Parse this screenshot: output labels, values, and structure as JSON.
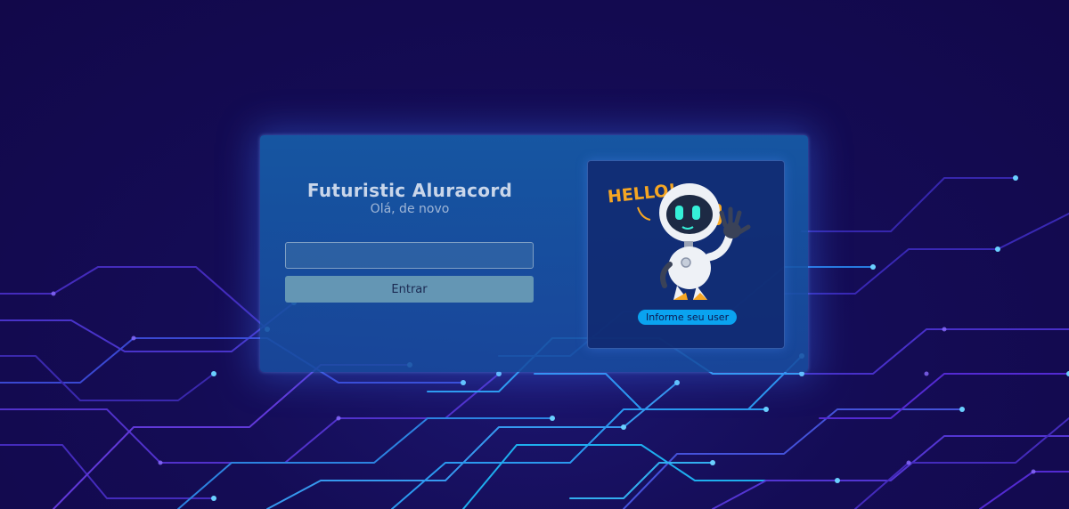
{
  "app": {
    "title": "Futuristic Aluracord",
    "subtitle": "Olá, de novo"
  },
  "form": {
    "username_value": "",
    "username_placeholder": "",
    "submit_label": "Entrar"
  },
  "avatar_panel": {
    "image": "robot-waving-hello-illustration",
    "image_text": "HELLO!",
    "badge_label": "Informe seu user"
  },
  "colors": {
    "background": "#12084a",
    "card": "#165ca8",
    "button": "#6496b4",
    "badge": "#0aa3f0",
    "circuit_blue": "#2ea8ff",
    "circuit_purple": "#5b2ee0"
  }
}
